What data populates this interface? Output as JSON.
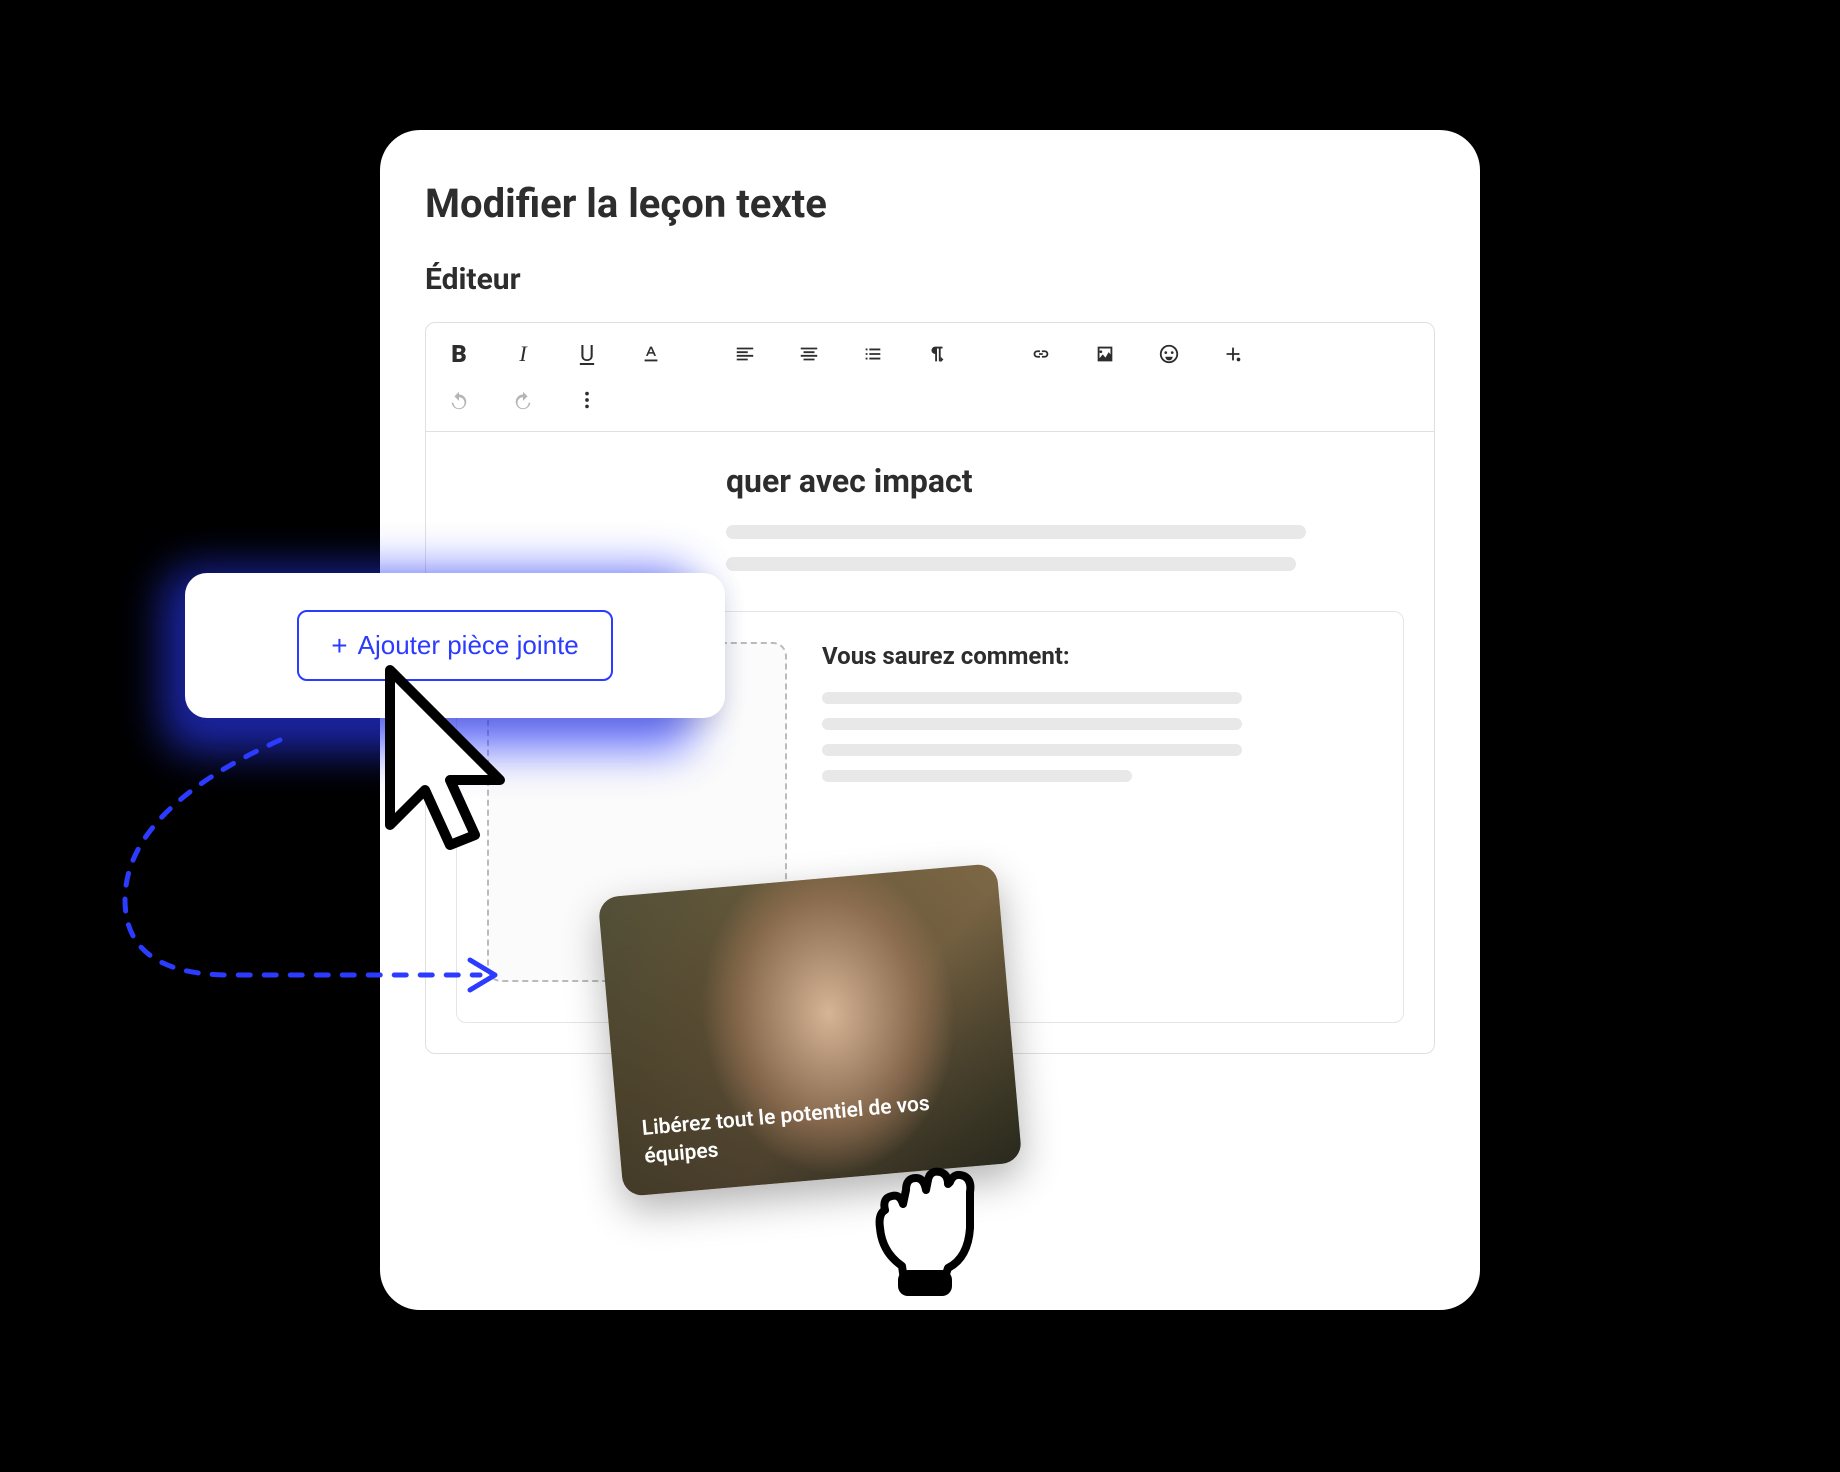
{
  "page": {
    "title": "Modifier la leçon texte",
    "section_label": "Éditeur"
  },
  "content": {
    "heading_suffix": "quer avec impact",
    "you_will_know": "Vous saurez comment:"
  },
  "attach": {
    "button_label": "Ajouter pièce jointe"
  },
  "drag_card": {
    "caption": "Libérez tout le potentiel de vos équipes"
  }
}
